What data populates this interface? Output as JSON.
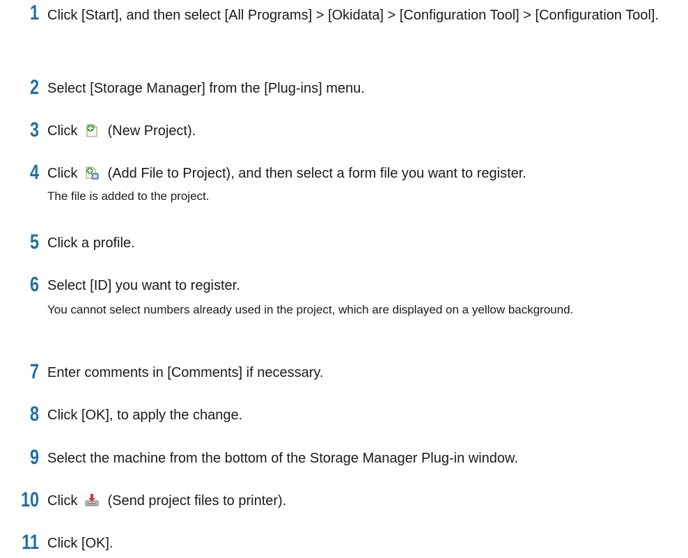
{
  "steps": [
    {
      "number": "1",
      "text": "Click [Start], and then select [All Programs] > [Okidata] > [Configuration Tool] > [Configuration Tool]."
    },
    {
      "number": "2",
      "text": "Select [Storage Manager] from the [Plug-ins] menu."
    },
    {
      "number": "3",
      "pre": "Click",
      "post": "(New Project).",
      "icon": "new-project-icon"
    },
    {
      "number": "4",
      "pre": "Click",
      "post": "(Add File to Project), and then select a form file you want to register.",
      "icon": "add-file-to-project-icon",
      "note": "The file is added to the project."
    },
    {
      "number": "5",
      "text": "Click a profile."
    },
    {
      "number": "6",
      "text": "Select [ID] you want to register.",
      "note": "You cannot select numbers already used in the project, which are displayed on a yellow background."
    },
    {
      "number": "7",
      "text": "Enter comments in [Comments] if necessary."
    },
    {
      "number": "8",
      "text": "Click [OK], to apply the change."
    },
    {
      "number": "9",
      "text": "Select the machine from the bottom of the Storage Manager Plug-in window."
    },
    {
      "number": "10",
      "pre": "Click",
      "post": "(Send project files to printer).",
      "icon": "send-to-printer-icon"
    },
    {
      "number": "11",
      "text": "Click [OK]."
    }
  ],
  "colors": {
    "step_number": "#1f6fa5",
    "text": "#1a1a1a"
  }
}
